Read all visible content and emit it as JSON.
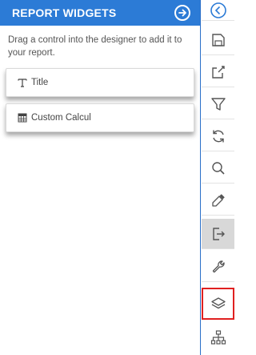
{
  "panel": {
    "title": "REPORT WIDGETS",
    "hint": "Drag a control into the designer to add it to your report.",
    "widgets": [
      {
        "label": "Title",
        "icon": "text-type-icon"
      },
      {
        "label": "Custom Calcul",
        "icon": "calculator-icon"
      }
    ]
  },
  "toolbar": {
    "items": [
      {
        "name": "back-icon"
      },
      {
        "name": "save-icon"
      },
      {
        "name": "export-icon"
      },
      {
        "name": "filter-icon"
      },
      {
        "name": "refresh-icon"
      },
      {
        "name": "search-icon"
      },
      {
        "name": "eyedropper-icon"
      },
      {
        "name": "sign-out-icon",
        "state": "active"
      },
      {
        "name": "wrench-icon"
      },
      {
        "name": "layers-icon",
        "state": "highlighted"
      },
      {
        "name": "hierarchy-icon"
      }
    ]
  },
  "colors": {
    "header_bg": "#2c7bd6",
    "icon_gray": "#555555",
    "highlight_red": "#e02020",
    "active_bg": "#d8d8d8"
  }
}
